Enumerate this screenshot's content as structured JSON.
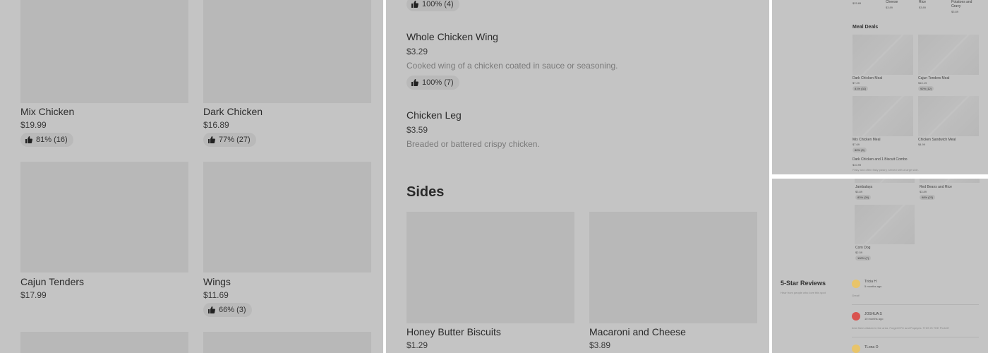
{
  "colors": {
    "overlay_bg": "#c4c4c4",
    "image_placeholder": "#b8b8b8",
    "rating_pill": "#b9b9b9",
    "avatar_yellow": "#e8c46a",
    "avatar_red": "#d9534f"
  },
  "left_panel": {
    "items": [
      {
        "name": "Mix Chicken",
        "price": "$19.99",
        "rating": "81% (16)"
      },
      {
        "name": "Dark Chicken",
        "price": "$16.89",
        "rating": "77% (27)"
      },
      {
        "name": "Cajun Tenders",
        "price": "$17.99"
      },
      {
        "name": "Wings",
        "price": "$11.69",
        "rating": "66% (3)"
      }
    ]
  },
  "mid_panel": {
    "top_rating": "100% (4)",
    "items": [
      {
        "name": "Whole Chicken Wing",
        "price": "$3.29",
        "description": "Cooked wing of a chicken coated in sauce or seasoning.",
        "rating": "100% (7)"
      },
      {
        "name": "Chicken Leg",
        "price": "$3.59",
        "description": "Breaded or battered crispy chicken."
      }
    ],
    "section_title": "Sides",
    "sides": [
      {
        "name": "Honey Butter Biscuits",
        "price": "$1.29"
      },
      {
        "name": "Macaroni and Cheese",
        "price": "$3.89"
      }
    ]
  },
  "top_right": {
    "top_row": [
      {
        "name": "",
        "price": "$25.89"
      },
      {
        "name": "Cheese",
        "price": "$3.89"
      },
      {
        "name": "Rice",
        "price": "$3.89"
      },
      {
        "name": "Potatoes and Gravy",
        "price": "$3.89"
      }
    ],
    "section_title": "Meal Deals",
    "meals": [
      {
        "name": "Dark Chicken Meal",
        "price": "$7.29",
        "rating": "81% (32)"
      },
      {
        "name": "Cajun Tenders Meal",
        "price": "$10.19",
        "rating": "92% (12)"
      },
      {
        "name": "Mix Chicken Meal",
        "price": "$7.69",
        "rating": "80% (5)"
      },
      {
        "name": "Chicken Sandwich Meal",
        "price": "$4.99"
      }
    ],
    "combo": {
      "name": "Dark Chicken and 1 Biscuit Combo",
      "price": "$10.99",
      "description": "Flaky and often flaky pastry, served with a large side."
    }
  },
  "bottom_right": {
    "items": [
      {
        "name": "Jambalaya",
        "price": "$3.89",
        "rating": "83% (26)"
      },
      {
        "name": "Red Beans and Rice",
        "price": "$3.89",
        "rating": "98% (23)"
      },
      {
        "name": "Corn Dog",
        "price": "$2.59",
        "rating": "100% (7)"
      }
    ],
    "reviews_title": "5-Star Reviews",
    "reviews_subtitle": "Hear from people who love this spot",
    "reviews": [
      {
        "author": "Tricia H",
        "time": "5 months ago",
        "text": "Great!"
      },
      {
        "author": "JOSHUA S",
        "time": "10 months ago",
        "text": "best fried chicken in the area. Forget KFC and Popeyes. THIS IS THE PLACE"
      },
      {
        "author": "TLona O",
        "time": ""
      }
    ]
  }
}
